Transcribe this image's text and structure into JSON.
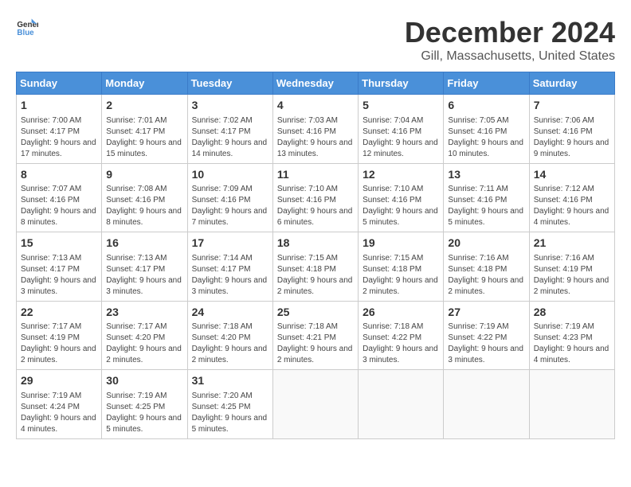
{
  "header": {
    "logo_general": "General",
    "logo_blue": "Blue",
    "month": "December 2024",
    "location": "Gill, Massachusetts, United States"
  },
  "weekdays": [
    "Sunday",
    "Monday",
    "Tuesday",
    "Wednesday",
    "Thursday",
    "Friday",
    "Saturday"
  ],
  "weeks": [
    [
      {
        "day": "1",
        "sunrise": "7:00 AM",
        "sunset": "4:17 PM",
        "daylight": "9 hours and 17 minutes."
      },
      {
        "day": "2",
        "sunrise": "7:01 AM",
        "sunset": "4:17 PM",
        "daylight": "9 hours and 15 minutes."
      },
      {
        "day": "3",
        "sunrise": "7:02 AM",
        "sunset": "4:17 PM",
        "daylight": "9 hours and 14 minutes."
      },
      {
        "day": "4",
        "sunrise": "7:03 AM",
        "sunset": "4:16 PM",
        "daylight": "9 hours and 13 minutes."
      },
      {
        "day": "5",
        "sunrise": "7:04 AM",
        "sunset": "4:16 PM",
        "daylight": "9 hours and 12 minutes."
      },
      {
        "day": "6",
        "sunrise": "7:05 AM",
        "sunset": "4:16 PM",
        "daylight": "9 hours and 10 minutes."
      },
      {
        "day": "7",
        "sunrise": "7:06 AM",
        "sunset": "4:16 PM",
        "daylight": "9 hours and 9 minutes."
      }
    ],
    [
      {
        "day": "8",
        "sunrise": "7:07 AM",
        "sunset": "4:16 PM",
        "daylight": "9 hours and 8 minutes."
      },
      {
        "day": "9",
        "sunrise": "7:08 AM",
        "sunset": "4:16 PM",
        "daylight": "9 hours and 8 minutes."
      },
      {
        "day": "10",
        "sunrise": "7:09 AM",
        "sunset": "4:16 PM",
        "daylight": "9 hours and 7 minutes."
      },
      {
        "day": "11",
        "sunrise": "7:10 AM",
        "sunset": "4:16 PM",
        "daylight": "9 hours and 6 minutes."
      },
      {
        "day": "12",
        "sunrise": "7:10 AM",
        "sunset": "4:16 PM",
        "daylight": "9 hours and 5 minutes."
      },
      {
        "day": "13",
        "sunrise": "7:11 AM",
        "sunset": "4:16 PM",
        "daylight": "9 hours and 5 minutes."
      },
      {
        "day": "14",
        "sunrise": "7:12 AM",
        "sunset": "4:16 PM",
        "daylight": "9 hours and 4 minutes."
      }
    ],
    [
      {
        "day": "15",
        "sunrise": "7:13 AM",
        "sunset": "4:17 PM",
        "daylight": "9 hours and 3 minutes."
      },
      {
        "day": "16",
        "sunrise": "7:13 AM",
        "sunset": "4:17 PM",
        "daylight": "9 hours and 3 minutes."
      },
      {
        "day": "17",
        "sunrise": "7:14 AM",
        "sunset": "4:17 PM",
        "daylight": "9 hours and 3 minutes."
      },
      {
        "day": "18",
        "sunrise": "7:15 AM",
        "sunset": "4:18 PM",
        "daylight": "9 hours and 2 minutes."
      },
      {
        "day": "19",
        "sunrise": "7:15 AM",
        "sunset": "4:18 PM",
        "daylight": "9 hours and 2 minutes."
      },
      {
        "day": "20",
        "sunrise": "7:16 AM",
        "sunset": "4:18 PM",
        "daylight": "9 hours and 2 minutes."
      },
      {
        "day": "21",
        "sunrise": "7:16 AM",
        "sunset": "4:19 PM",
        "daylight": "9 hours and 2 minutes."
      }
    ],
    [
      {
        "day": "22",
        "sunrise": "7:17 AM",
        "sunset": "4:19 PM",
        "daylight": "9 hours and 2 minutes."
      },
      {
        "day": "23",
        "sunrise": "7:17 AM",
        "sunset": "4:20 PM",
        "daylight": "9 hours and 2 minutes."
      },
      {
        "day": "24",
        "sunrise": "7:18 AM",
        "sunset": "4:20 PM",
        "daylight": "9 hours and 2 minutes."
      },
      {
        "day": "25",
        "sunrise": "7:18 AM",
        "sunset": "4:21 PM",
        "daylight": "9 hours and 2 minutes."
      },
      {
        "day": "26",
        "sunrise": "7:18 AM",
        "sunset": "4:22 PM",
        "daylight": "9 hours and 3 minutes."
      },
      {
        "day": "27",
        "sunrise": "7:19 AM",
        "sunset": "4:22 PM",
        "daylight": "9 hours and 3 minutes."
      },
      {
        "day": "28",
        "sunrise": "7:19 AM",
        "sunset": "4:23 PM",
        "daylight": "9 hours and 4 minutes."
      }
    ],
    [
      {
        "day": "29",
        "sunrise": "7:19 AM",
        "sunset": "4:24 PM",
        "daylight": "9 hours and 4 minutes."
      },
      {
        "day": "30",
        "sunrise": "7:19 AM",
        "sunset": "4:25 PM",
        "daylight": "9 hours and 5 minutes."
      },
      {
        "day": "31",
        "sunrise": "7:20 AM",
        "sunset": "4:25 PM",
        "daylight": "9 hours and 5 minutes."
      },
      null,
      null,
      null,
      null
    ]
  ]
}
